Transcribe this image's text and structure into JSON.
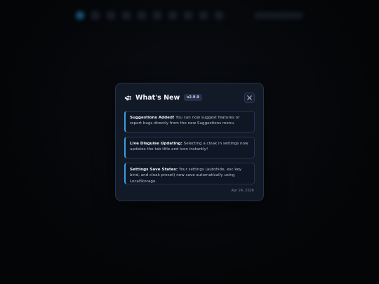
{
  "modal": {
    "title": "What's New",
    "version": "v2.9.9",
    "close_label": "Close",
    "date": "Apr 24, 2026"
  },
  "updates": [
    {
      "heading": "Suggestions Added!",
      "text": " You can now suggest features or report bugs directly from the new Suggestions menu."
    },
    {
      "heading": "Live Disguise Updating:",
      "text": " Selecting a cloak in settings now updates the tab title and icon instantly!"
    },
    {
      "heading": "Settings Save States:",
      "text": " Your settings (autohide, esc key bind, and cloak preset) now save automatically using LocalStorage."
    }
  ],
  "colors": {
    "accent": "#3aa0e0",
    "modal_bg": "#121a28",
    "card_bg": "#0f1624"
  },
  "icons": {
    "header": "megaphone-icon",
    "close": "close-icon"
  }
}
